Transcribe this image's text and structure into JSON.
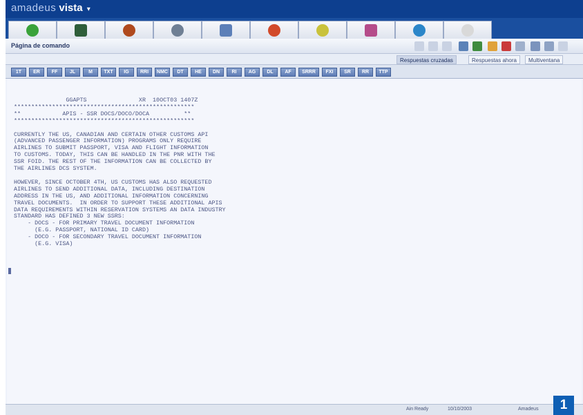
{
  "brand": {
    "name_light": "amadeus",
    "name_bold": "vista",
    "caret": "▾"
  },
  "icon_tabs": [
    {
      "icon": "seats-icon",
      "color": "#3aa23a"
    },
    {
      "icon": "globe-dark-icon",
      "color": "#2f5e3a"
    },
    {
      "icon": "person-icon",
      "color": "#b04a1e"
    },
    {
      "icon": "tools-icon",
      "color": "#6f7f94"
    },
    {
      "icon": "car-icon",
      "color": "#5c7fb8"
    },
    {
      "icon": "agent-icon",
      "color": "#d24a2a"
    },
    {
      "icon": "hotel-icon",
      "color": "#c9c23c"
    },
    {
      "icon": "document-icon",
      "color": "#b54c8a"
    },
    {
      "icon": "earth-icon",
      "color": "#2b86c9"
    },
    {
      "icon": "calendar-icon",
      "color": "#d9d9d9"
    }
  ],
  "cmd_bar": {
    "title": "Página de comando"
  },
  "sub_tabs": [
    {
      "label": "Respuestas cruzadas",
      "active": true
    },
    {
      "label": "Respuestas ahora",
      "active": false
    },
    {
      "label": "Multiventana",
      "active": false
    }
  ],
  "fkeys": [
    "1T",
    "ER",
    "FF",
    "JL",
    "M",
    "TXT",
    "IG",
    "RRI",
    "NMC",
    "DT",
    "HE",
    "DN",
    "RI",
    "AG",
    "DL",
    "AF",
    "SRRR",
    "FXI",
    "SR",
    "RR",
    "TTP"
  ],
  "terminal": {
    "lines": [
      "               GGAPTS               XR  10OCT03 1407Z",
      "****************************************************",
      "**            APIS - SSR DOCS/DOCO/DOCA          **",
      "****************************************************",
      "",
      "CURRENTLY THE US, CANADIAN AND CERTAIN OTHER CUSTOMS API",
      "(ADVANCED PASSENGER INFORMATION) PROGRAMS ONLY REQUIRE",
      "AIRLINES TO SUBMIT PASSPORT, VISA AND FLIGHT INFORMATION",
      "TO CUSTOMS. TODAY, THIS CAN BE HANDLED IN THE PNR WITH THE",
      "SSR FOID. THE REST OF THE INFORMATION CAN BE COLLECTED BY",
      "THE AIRLINES DCS SYSTEM.",
      "",
      "HOWEVER, SINCE OCTOBER 4TH, US CUSTOMS HAS ALSO REQUESTED",
      "AIRLINES TO SEND ADDITIONAL DATA, INCLUDING DESTINATION",
      "ADDRESS IN THE US, AND ADDITIONAL INFORMATION CONCERNING",
      "TRAVEL DOCUMENTS.  IN ORDER TO SUPPORT THESE ADDITIONAL APIS",
      "DATA REQUIREMENTS WITHIN RESERVATION SYSTEMS AN DATA INDUSTRY",
      "STANDARD HAS DEFINED 3 NEW SSRS:",
      "    - DOCS - FOR PRIMARY TRAVEL DOCUMENT INFORMATION",
      "      (E.G. PASSPORT, NATIONAL ID CARD)",
      "    - DOCO - FOR SECONDARY TRAVEL DOCUMENT INFORMATION",
      "      (E.G. VISA)"
    ],
    "cursor": ">"
  },
  "status_bar": {
    "left": "Ain Ready",
    "mid": "10/10/2003",
    "right": "Amadeus"
  },
  "badge": "1"
}
